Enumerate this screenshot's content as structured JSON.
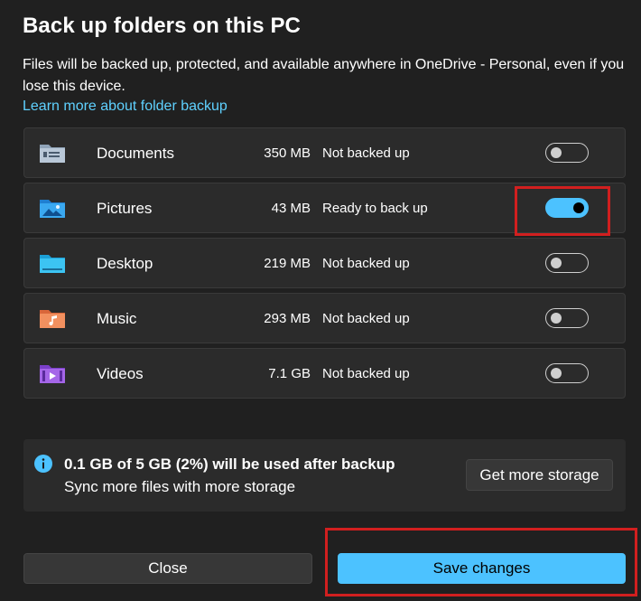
{
  "dialog": {
    "title": "Back up folders on this PC",
    "description": "Files will be backed up, protected, and available anywhere in OneDrive - Personal, even if you lose this device.",
    "learn_more": "Learn more about folder backup"
  },
  "folders": [
    {
      "name": "Documents",
      "size": "350 MB",
      "status": "Not backed up",
      "enabled": false,
      "icon": "documents-folder-icon"
    },
    {
      "name": "Pictures",
      "size": "43 MB",
      "status": "Ready to back up",
      "enabled": true,
      "icon": "pictures-folder-icon"
    },
    {
      "name": "Desktop",
      "size": "219 MB",
      "status": "Not backed up",
      "enabled": false,
      "icon": "desktop-folder-icon"
    },
    {
      "name": "Music",
      "size": "293 MB",
      "status": "Not backed up",
      "enabled": false,
      "icon": "music-folder-icon"
    },
    {
      "name": "Videos",
      "size": "7.1 GB",
      "status": "Not backed up",
      "enabled": false,
      "icon": "videos-folder-icon"
    }
  ],
  "storage": {
    "main": "0.1 GB of 5 GB (2%) will be used after backup",
    "sub": "Sync more files with more storage",
    "button": "Get more storage"
  },
  "footer": {
    "close": "Close",
    "save": "Save changes"
  },
  "colors": {
    "background": "#202020",
    "card": "#2b2b2b",
    "accent": "#4cc2ff",
    "link": "#5fd1ff",
    "highlight": "#d11f1f"
  }
}
